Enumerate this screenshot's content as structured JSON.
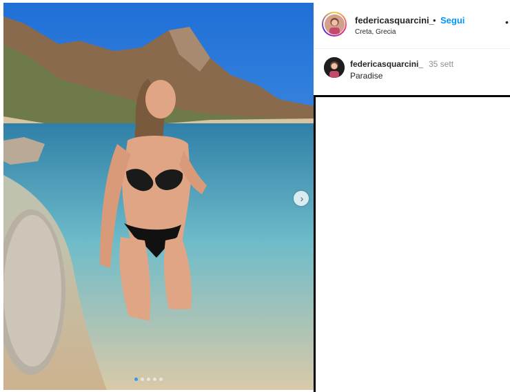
{
  "post": {
    "username": "federicasquarcini_",
    "separator": "•",
    "follow_label": "Segui",
    "location": "Creta, Grecia",
    "more_label": "•",
    "next_label": "›"
  },
  "comment": {
    "username": "federicasquarcini_",
    "time": "35 sett",
    "text": "Paradise"
  },
  "carousel": {
    "total": 5,
    "active_index": 0
  },
  "colors": {
    "follow": "#0095f6",
    "sky": "#3b8fe0",
    "sea": "#5fb3c9",
    "sand": "#e8d2b8"
  }
}
